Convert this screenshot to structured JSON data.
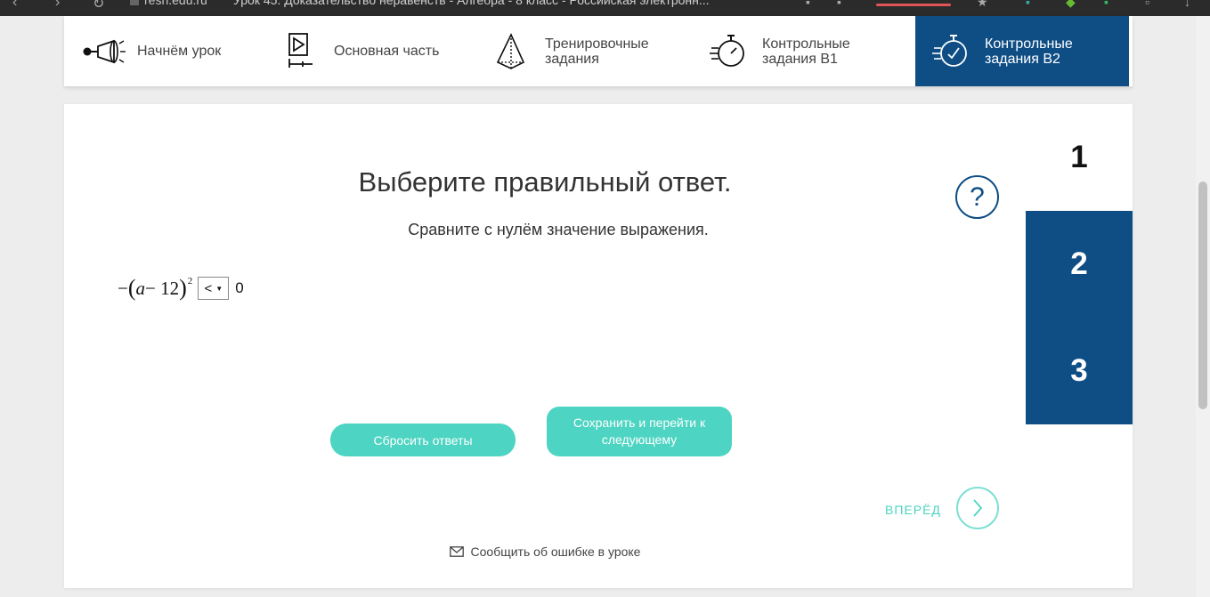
{
  "browser": {
    "back_glyph": "‹",
    "forward_glyph": "›",
    "reload_glyph": "↻",
    "url": "resh.edu.ru",
    "title": "Урок 45. Доказательство неравенств - Алгебра - 8 класс - Российская электронн..."
  },
  "lesson_nav": {
    "items": [
      {
        "label": "Начнём урок",
        "icon": "megaphone-icon"
      },
      {
        "label": "Основная часть",
        "icon": "play-icon"
      },
      {
        "label": "Тренировочные\nзадания",
        "icon": "pyramid-icon"
      },
      {
        "label": "Контрольные\nзадания В1",
        "icon": "stopwatch-icon"
      },
      {
        "label": "Контрольные\nзадания В2",
        "icon": "stopwatch-check-icon"
      }
    ],
    "active_index": 4
  },
  "task": {
    "title": "Выберите правильный ответ.",
    "subtitle": "Сравните с нулём значение выражения.",
    "help_glyph": "?",
    "expression": {
      "minus": "−",
      "open_paren": "(",
      "var": "a",
      "op": " − 12",
      "close_paren": ")",
      "exponent": "2",
      "selected": "<",
      "rhs": "0"
    }
  },
  "buttons": {
    "reset": "Сбросить ответы",
    "save_next": "Сохранить и перейти к следующему"
  },
  "forward": {
    "label": "ВПЕРЁД"
  },
  "report": {
    "label": "Сообщить об ошибке в уроке"
  },
  "pager": {
    "pages": [
      "1",
      "2",
      "3"
    ],
    "current": "1"
  },
  "colors": {
    "accent_blue": "#0e4e85",
    "teal": "#4dd4c2"
  }
}
